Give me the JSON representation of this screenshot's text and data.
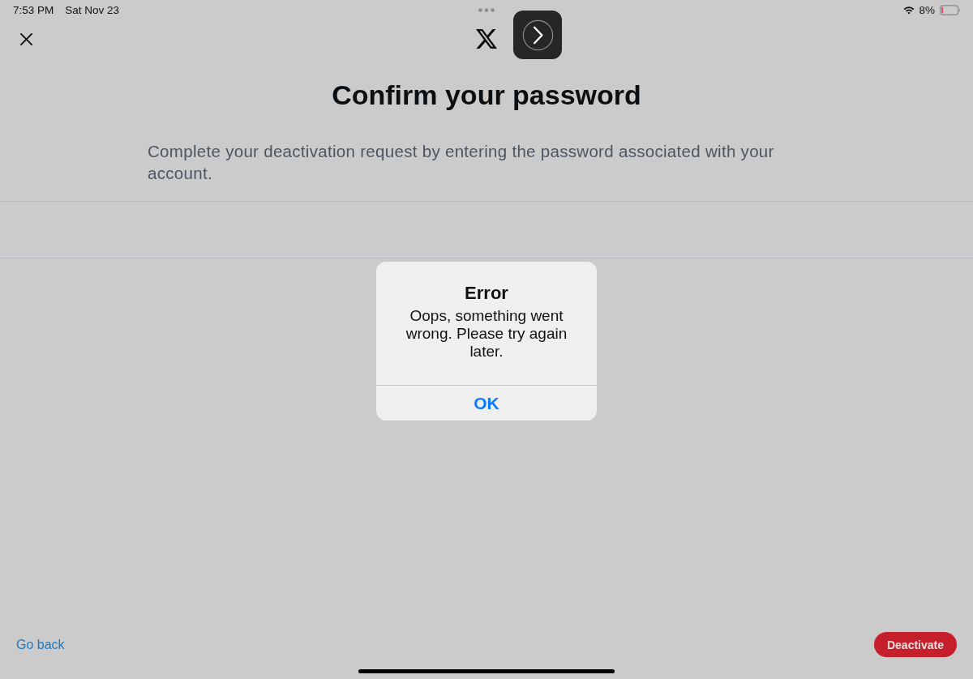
{
  "status_bar": {
    "time": "7:53 PM",
    "date": "Sat Nov 23",
    "battery_percent": "8%"
  },
  "page": {
    "title": "Confirm your password",
    "description": "Complete your deactivation request by entering the password associated with your account."
  },
  "alert": {
    "title": "Error",
    "message": "Oops, something went wrong. Please try again later.",
    "buttons": [
      {
        "label": "OK"
      }
    ]
  },
  "footer": {
    "back_link": "Go back",
    "deactivate_button": "Deactivate"
  }
}
